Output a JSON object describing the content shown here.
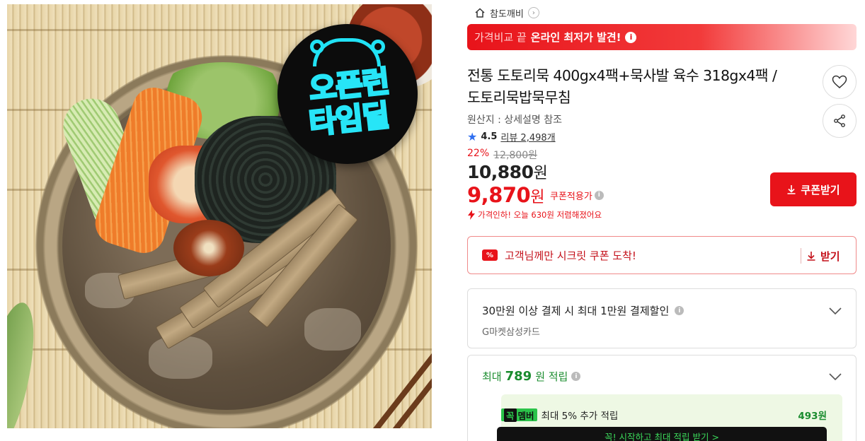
{
  "image": {
    "badge_line1": "오픈런",
    "badge_line2": "타임딜"
  },
  "seller": {
    "name": "참도깨비",
    "icon": "home-icon"
  },
  "compare_banner": {
    "prefix": "가격비교 끝",
    "highlight": "온라인 최저가 발견!",
    "info_icon": "i"
  },
  "product": {
    "title_line1": "전통 도토리묵 400gx4팩+묵사발 육수 318gx4팩 /",
    "title_line2": "도토리묵밥묵무침",
    "origin": "원산지 : 상세설명 참조",
    "rating": "4.5",
    "review_label": "리뷰 2,498개"
  },
  "price": {
    "discount_rate": "22%",
    "list_price": "12,800원",
    "sale_price": "10,880",
    "sale_unit": "원",
    "coupon_price": "9,870",
    "coupon_unit": "원",
    "coupon_applied_label": "쿠폰적용가",
    "price_drop_note": "가격인하! 오늘 630원 저렴해졌어요"
  },
  "coupon_button": {
    "label": "쿠폰받기"
  },
  "secret_coupon": {
    "tag": "%",
    "text": "고객님께만 시크릿 쿠폰 도착!",
    "action": "받기"
  },
  "card_discount": {
    "title": "30만원 이상 결제 시 최대 1만원 결제할인",
    "subtitle": "G마켓삼성카드"
  },
  "points": {
    "prefix": "최대",
    "amount": "789",
    "suffix": "원 적립",
    "member_badge_dark": "꼭",
    "member_badge_light": "멤버",
    "member_text": "최대 5% 추가 적립",
    "member_amount": "493원",
    "member_cta": "꼭! 시작하고 최대 적립 받기  >"
  },
  "colors": {
    "accent_red": "#e8131a",
    "point_green": "#1a8c2e",
    "badge_neon": "#27e5f7"
  }
}
